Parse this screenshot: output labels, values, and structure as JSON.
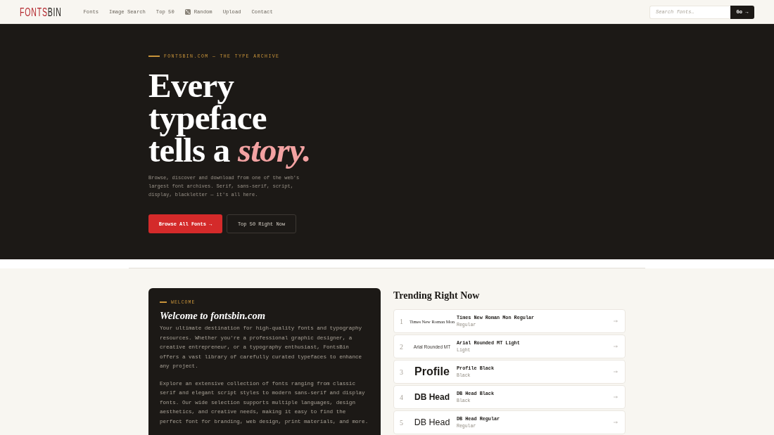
{
  "header": {
    "logo": {
      "accent": "FONTS",
      "rest": "BIN"
    },
    "nav": [
      {
        "label": "Fonts",
        "has_icon": false
      },
      {
        "label": "Image Search",
        "has_icon": false
      },
      {
        "label": "Top 50",
        "has_icon": false
      },
      {
        "label": "Random",
        "has_icon": true
      },
      {
        "label": "Upload",
        "has_icon": false
      },
      {
        "label": "Contact",
        "has_icon": false
      }
    ],
    "search": {
      "placeholder": "Search fonts…",
      "button": "Go →"
    }
  },
  "hero": {
    "eyebrow": "FONTSBIN.COM — THE TYPE ARCHIVE",
    "headline_lines": [
      "Every",
      "typeface",
      "tells a *story.*"
    ],
    "description": "Browse, discover and download from one of the web's largest font archives. Serif, sans-serif, script, display, blackletter — it's all here.",
    "buttons": [
      {
        "label": "Browse All Fonts →",
        "kind": "primary"
      },
      {
        "label": "Top 50 Right Now",
        "kind": "secondary"
      }
    ]
  },
  "welcome": {
    "eyebrow": "WELCOME",
    "title": "Welcome to fontsbin.com",
    "paragraphs": [
      "Your ultimate destination for high-quality fonts and typography resources. Whether you're a professional graphic designer, a creative entrepreneur, or a typography enthusiast, FontsBin offers a vast library of carefully curated typefaces to enhance any project.",
      "Explore an extensive collection of fonts ranging from classic serif and elegant script styles to modern sans-serif and display fonts. Our wide selection supports multiple languages, design aesthetics, and creative needs, making it easy to find the perfect font for branding, web design, print materials, and more."
    ]
  },
  "trending": {
    "title": "Trending Right Now",
    "items": [
      {
        "rank": "1",
        "preview": {
          "text": "Times New Roman Mon",
          "kind": "serif-tiny"
        },
        "name": "Times New Roman Mon Regular",
        "style": "Regular"
      },
      {
        "rank": "2",
        "preview": {
          "text": "Arial Rounded MT",
          "kind": "sans-small"
        },
        "name": "Arial Rounded MT Light",
        "style": "Light"
      },
      {
        "rank": "3",
        "preview": {
          "text": "Profile",
          "kind": "sans-black"
        },
        "name": "Profile Black",
        "style": "Black"
      },
      {
        "rank": "4",
        "preview": {
          "text": "DB Head",
          "kind": "sans-bold"
        },
        "name": "DB Head Black",
        "style": "Black"
      },
      {
        "rank": "5",
        "preview": {
          "text": "DB Head",
          "kind": "sans-regular"
        },
        "name": "DB Head Regular",
        "style": "Regular"
      }
    ]
  }
}
